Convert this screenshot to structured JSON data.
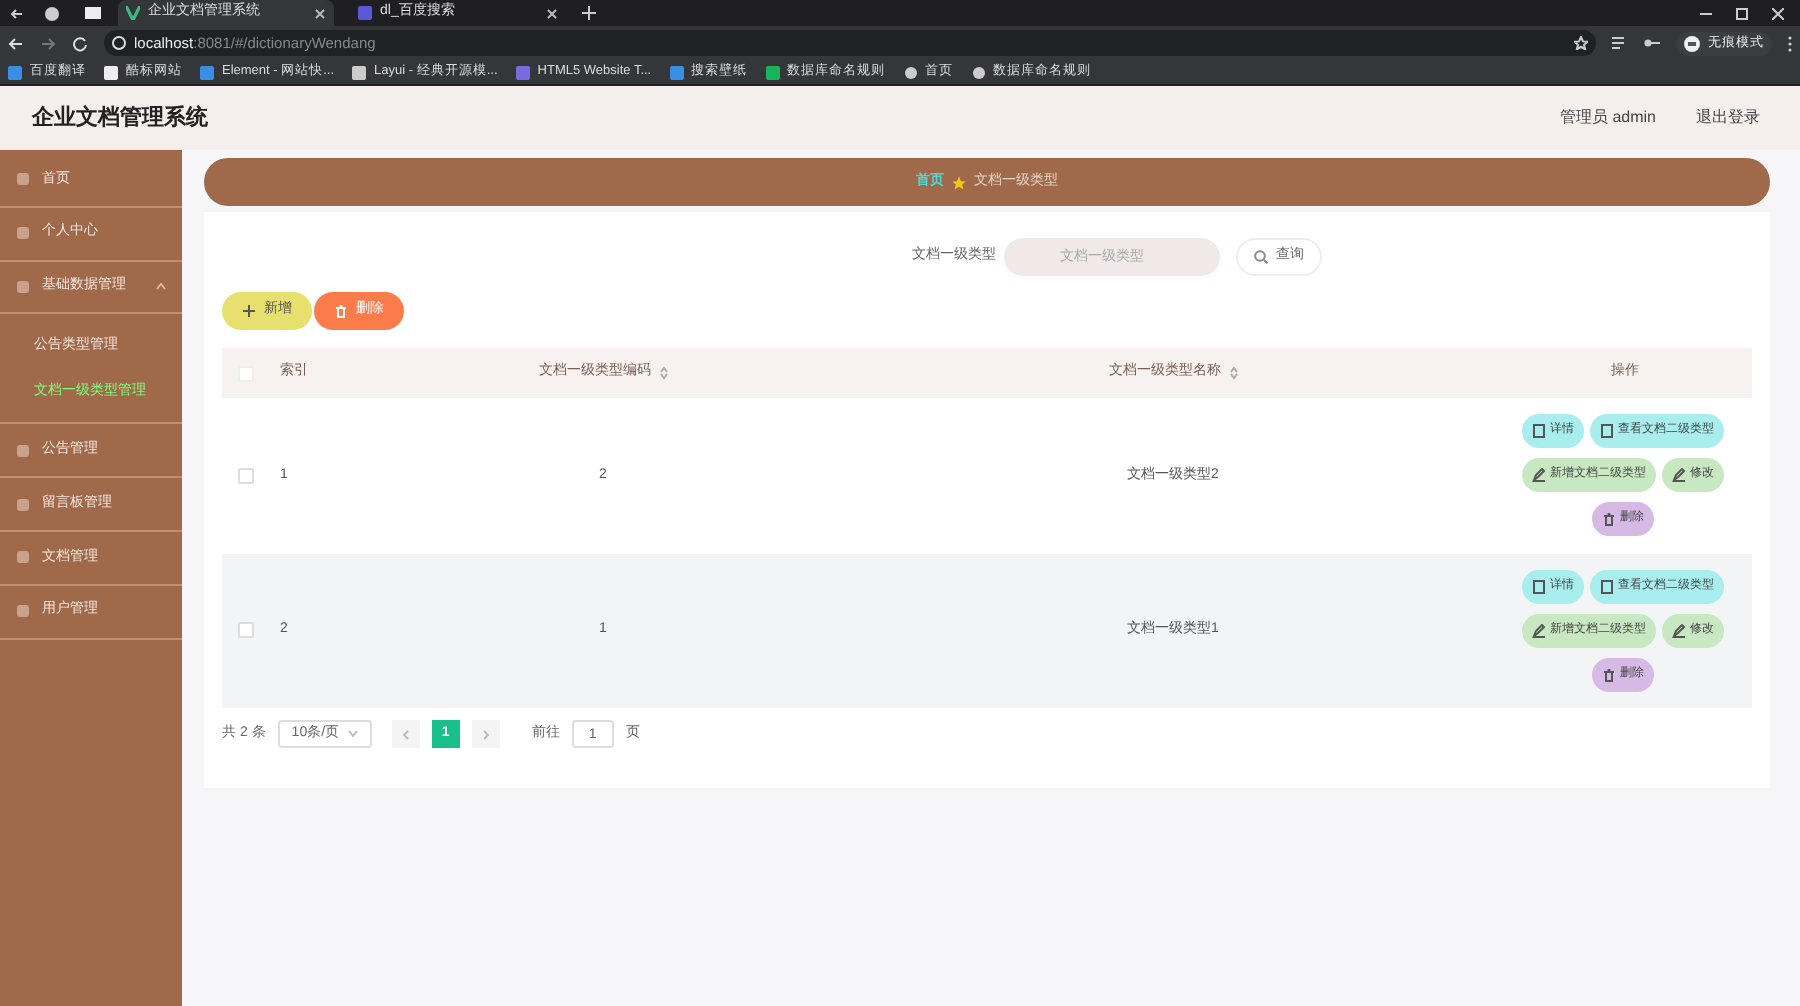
{
  "browser": {
    "tabs": [
      {
        "title": "企业文档管理系统",
        "selected": true
      },
      {
        "title": "dl_百度搜索",
        "selected": false
      }
    ],
    "address": {
      "host": "localhost",
      "path": ":8081/#/dictionaryWendang"
    },
    "profile": "无痕模式",
    "bookmarks": [
      "百度翻译",
      "酷标网站",
      "Element - 网站快...",
      "Layui - 经典开源模...",
      "HTML5 Website T...",
      "搜索壁纸",
      "数据库命名规则",
      "首页",
      "数据库命名规则"
    ]
  },
  "app": {
    "title": "企业文档管理系统",
    "user": "管理员 admin",
    "logout": "退出登录"
  },
  "sidebar": {
    "items": [
      {
        "label": "首页",
        "selected": false
      },
      {
        "label": "个人中心",
        "selected": false
      },
      {
        "label": "基础数据管理",
        "expanded": true,
        "selected": false,
        "children": [
          {
            "label": "公告类型管理",
            "selected": false
          },
          {
            "label": "文档一级类型管理",
            "selected": true
          }
        ]
      },
      {
        "label": "公告管理",
        "selected": false
      },
      {
        "label": "留言板管理",
        "selected": false
      },
      {
        "label": "文档管理",
        "selected": false
      },
      {
        "label": "用户管理",
        "selected": false
      }
    ]
  },
  "breadcrumb": [
    "首页",
    "文档一级类型"
  ],
  "search": {
    "label": "文档一级类型",
    "placeholder": "文档一级类型",
    "button": "查询"
  },
  "actions": [
    "新增",
    "删除"
  ],
  "table": {
    "all_checked": false,
    "columns": [
      "索引",
      "文档一级类型编码",
      "文档一级类型名称",
      "操作"
    ],
    "rows": [
      {
        "index": "1",
        "code": "2",
        "name": "文档一级类型2",
        "checked": false,
        "buttons": [
          "详情",
          "查看文档二级类型",
          "新增文档二级类型",
          "修改",
          "删除"
        ]
      },
      {
        "index": "2",
        "code": "1",
        "name": "文档一级类型1",
        "checked": false,
        "buttons": [
          "详情",
          "查看文档二级类型",
          "新增文档二级类型",
          "修改",
          "删除"
        ]
      }
    ]
  },
  "pagination": {
    "total": "共 2 条",
    "page_size": "10条/页",
    "pages": [
      {
        "label": "1",
        "selected": true
      }
    ],
    "goto_label": "前往",
    "goto_value": "1",
    "goto_suffix": "页"
  }
}
